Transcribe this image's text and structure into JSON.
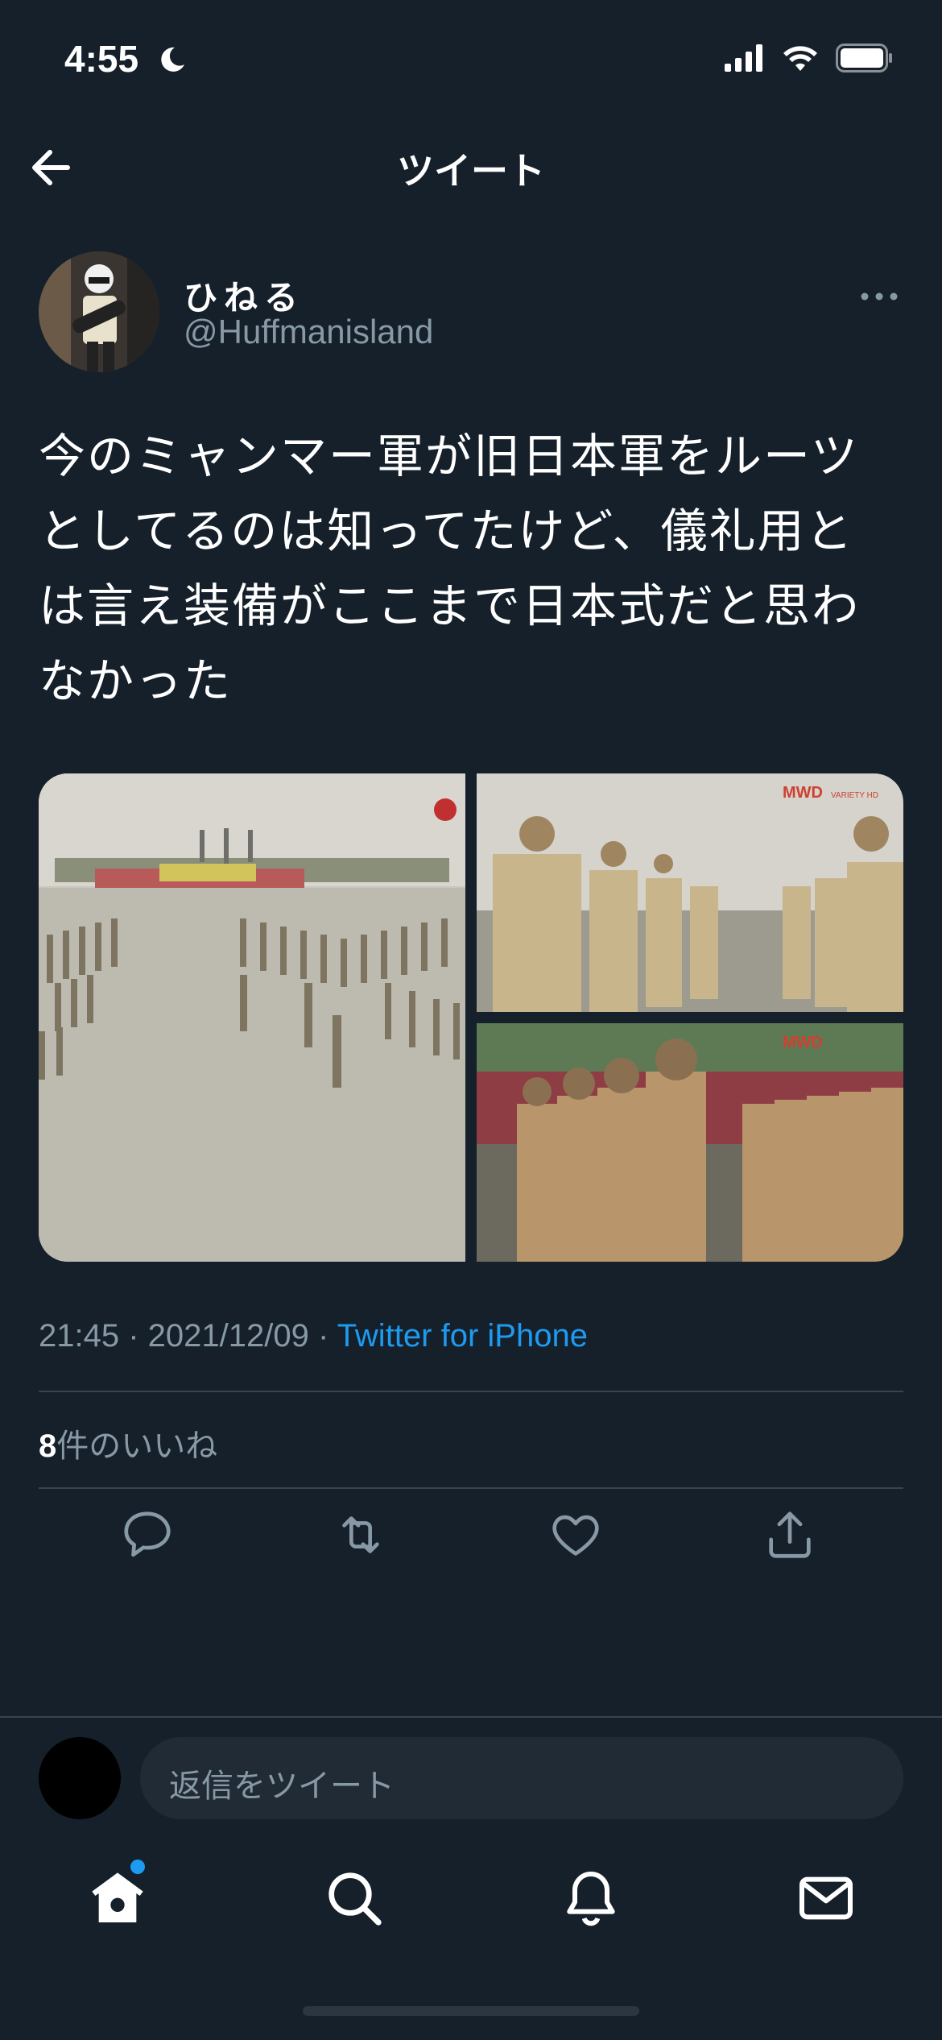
{
  "status_bar": {
    "time": "4:55"
  },
  "nav": {
    "title": "ツイート"
  },
  "author": {
    "name": "ひねる",
    "handle": "@Huffmanisland"
  },
  "tweet": {
    "text_lines": [
      "今のミャンマー軍が旧日本軍をルーツ",
      "としてるのは知ってたけど、儀礼用と",
      "は言え装備がここまで日本式だと思わ",
      "なかった"
    ],
    "media_watermark": "MWD",
    "media_watermark_sub": "VARIETY HD"
  },
  "meta": {
    "time": "21:45",
    "sep": " · ",
    "date": "2021/12/09",
    "source": "Twitter for iPhone"
  },
  "likes": {
    "count": "8",
    "label": "件のいいね"
  },
  "reply": {
    "placeholder": "返信をツイート"
  },
  "colors": {
    "background": "#15202b",
    "accent": "#1d9bf0",
    "muted": "#8899a6"
  }
}
